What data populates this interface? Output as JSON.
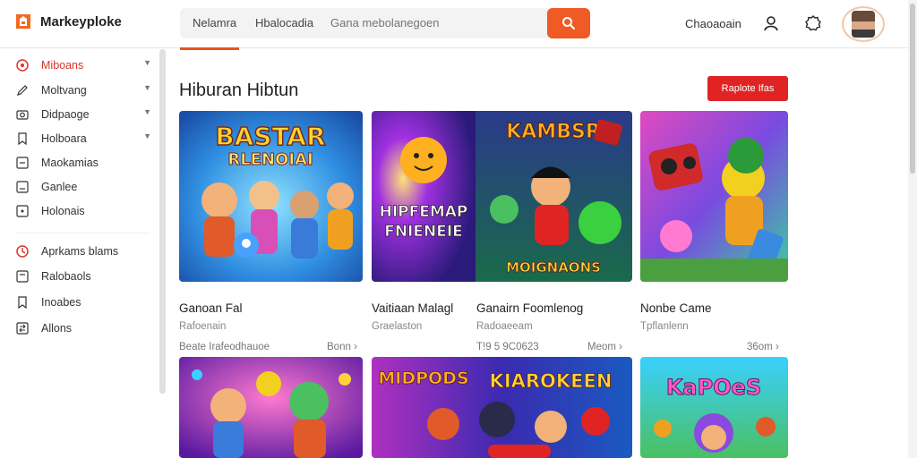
{
  "app": {
    "name": "Markeyploke"
  },
  "search": {
    "tabs": [
      "Nelamra",
      "Hbalocadia"
    ],
    "placeholder": "Gana mebolanegoen"
  },
  "topbar": {
    "link": "Chaoaoain"
  },
  "sidebar": {
    "items": [
      {
        "label": "Miboans",
        "icon": "target-icon",
        "caret": true,
        "active": true
      },
      {
        "label": "Moltvang",
        "icon": "pencil-icon",
        "caret": true
      },
      {
        "label": "Didpaoge",
        "icon": "camera-icon",
        "caret": true
      },
      {
        "label": "Holboara",
        "icon": "bookmark-icon",
        "caret": true
      },
      {
        "label": "Maokamias",
        "icon": "minus-box-icon",
        "caret": false
      },
      {
        "label": "Ganlee",
        "icon": "box-icon",
        "caret": false
      },
      {
        "label": "Holonais",
        "icon": "box-icon",
        "caret": false
      },
      {
        "label": "Aprkams blams",
        "icon": "target-icon",
        "caret": false
      },
      {
        "label": "Ralobaols",
        "icon": "box-icon",
        "caret": false
      },
      {
        "label": "Inoabes",
        "icon": "bookmark-icon",
        "caret": false
      },
      {
        "label": "Allons",
        "icon": "swap-icon",
        "caret": false
      }
    ]
  },
  "main": {
    "title": "Hiburan Hibtun",
    "cta_label": "Raplote Ifas",
    "cards": [
      {
        "title": "Ganoan Fal",
        "subtitle": "Rafoenain",
        "meta": "Beate Irafeodhauoe",
        "more": "Bonn"
      },
      {
        "title": "Vaitiaan Malagl",
        "subtitle": "Graelaston",
        "meta": "",
        "more": ""
      },
      {
        "title": "Ganairn Foomlenog",
        "subtitle": "Radoaeeam",
        "meta": "T!9 5 9C0623",
        "more": "Meom"
      },
      {
        "title": "Nonbe Came",
        "subtitle": "Tpflanlenn",
        "meta": "",
        "more": "36om"
      }
    ],
    "thumb_text": {
      "card1": [
        "BASTAR",
        "RLENOIAI"
      ],
      "card2": [
        "HIPFEMAP",
        "FNIENEIE"
      ],
      "card3": [
        "KAMBSR",
        "MOIGNAONS"
      ],
      "row2_card2": [
        "MIDPODS",
        "KIAROKEEN"
      ],
      "row2_card3": [
        "KaPOeS"
      ]
    }
  },
  "colors": {
    "accent": "#f05a24",
    "cta": "#e02424",
    "active": "#d9342b"
  }
}
